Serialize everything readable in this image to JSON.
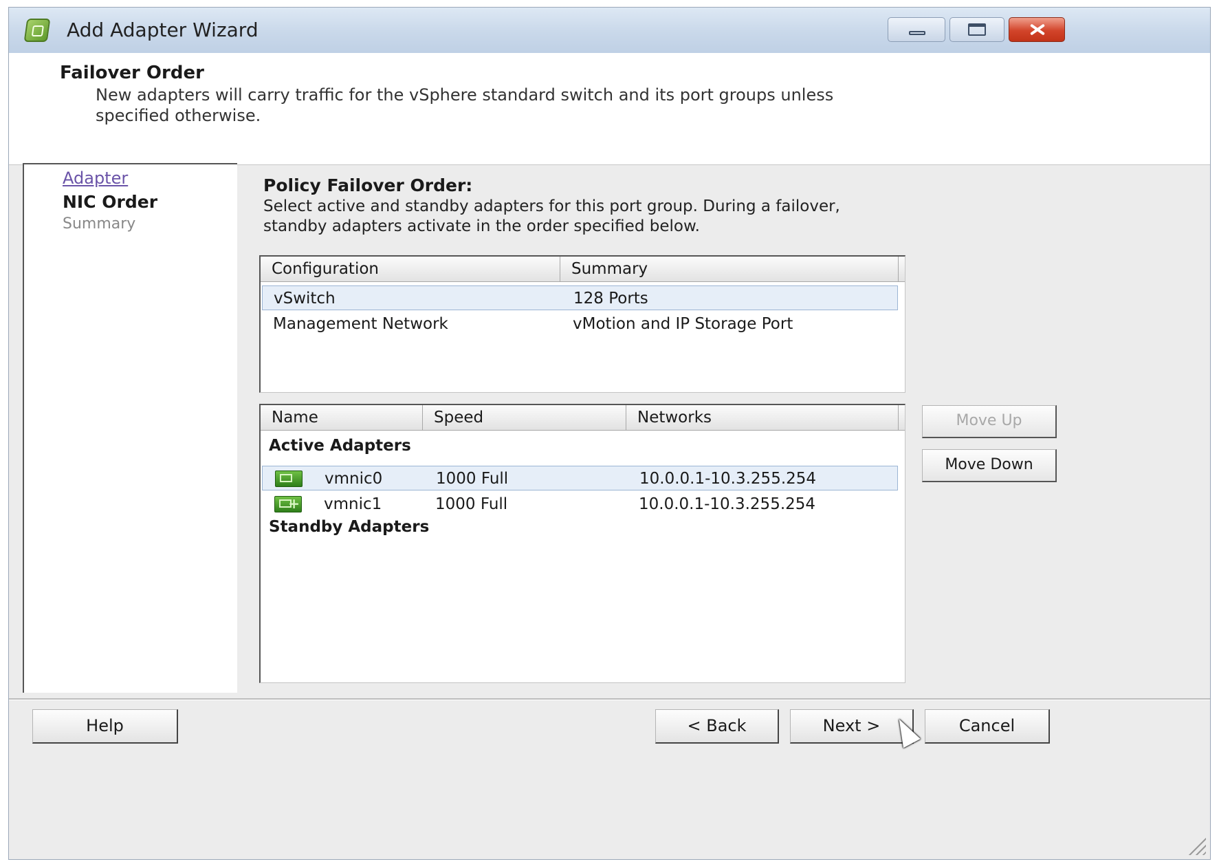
{
  "window": {
    "title": "Add Adapter Wizard",
    "icons": {
      "app": "wizard-app-icon",
      "minimize": "minimize-icon",
      "maximize": "maximize-icon",
      "close": "close-icon"
    }
  },
  "header": {
    "title": "Failover Order",
    "description": "New adapters will carry traffic for the vSphere standard switch and its port groups unless specified otherwise."
  },
  "sidebar": {
    "steps": [
      {
        "label": "Adapter",
        "state": "completed"
      },
      {
        "label": "NIC Order",
        "state": "current"
      },
      {
        "label": "Summary",
        "state": "pending"
      }
    ]
  },
  "main": {
    "title": "Policy Failover Order:",
    "description": "Select active and standby adapters for this port group. During a failover, standby adapters activate in the order specified below.",
    "config_table": {
      "columns": [
        "Configuration",
        "Summary"
      ],
      "rows": [
        {
          "configuration": "vSwitch",
          "summary": "128 Ports",
          "selected": true
        },
        {
          "configuration": "Management Network",
          "summary": "vMotion and IP Storage Port",
          "selected": false
        }
      ]
    },
    "adapter_table": {
      "columns": [
        "Name",
        "Speed",
        "Networks"
      ],
      "groups": {
        "active_label": "Active Adapters",
        "standby_label": "Standby Adapters"
      },
      "active": [
        {
          "name": "vmnic0",
          "speed": "1000 Full",
          "networks": "10.0.0.1-10.3.255.254",
          "icon": "nic-icon",
          "selected": true
        },
        {
          "name": "vmnic1",
          "speed": "1000 Full",
          "networks": "10.0.0.1-10.3.255.254",
          "icon": "nic-add-icon",
          "selected": false
        }
      ],
      "standby": []
    },
    "move_up_label": "Move Up",
    "move_up_enabled": false,
    "move_down_label": "Move Down",
    "move_down_enabled": true
  },
  "footer": {
    "help_label": "Help",
    "back_label": "< Back",
    "next_label": "Next >",
    "cancel_label": "Cancel"
  },
  "colors": {
    "titlebar": "#c9d8ea",
    "selection": "#e6eef8",
    "link": "#6a53a8",
    "nic_green": "#2f7f1a",
    "close_red": "#c23318"
  }
}
